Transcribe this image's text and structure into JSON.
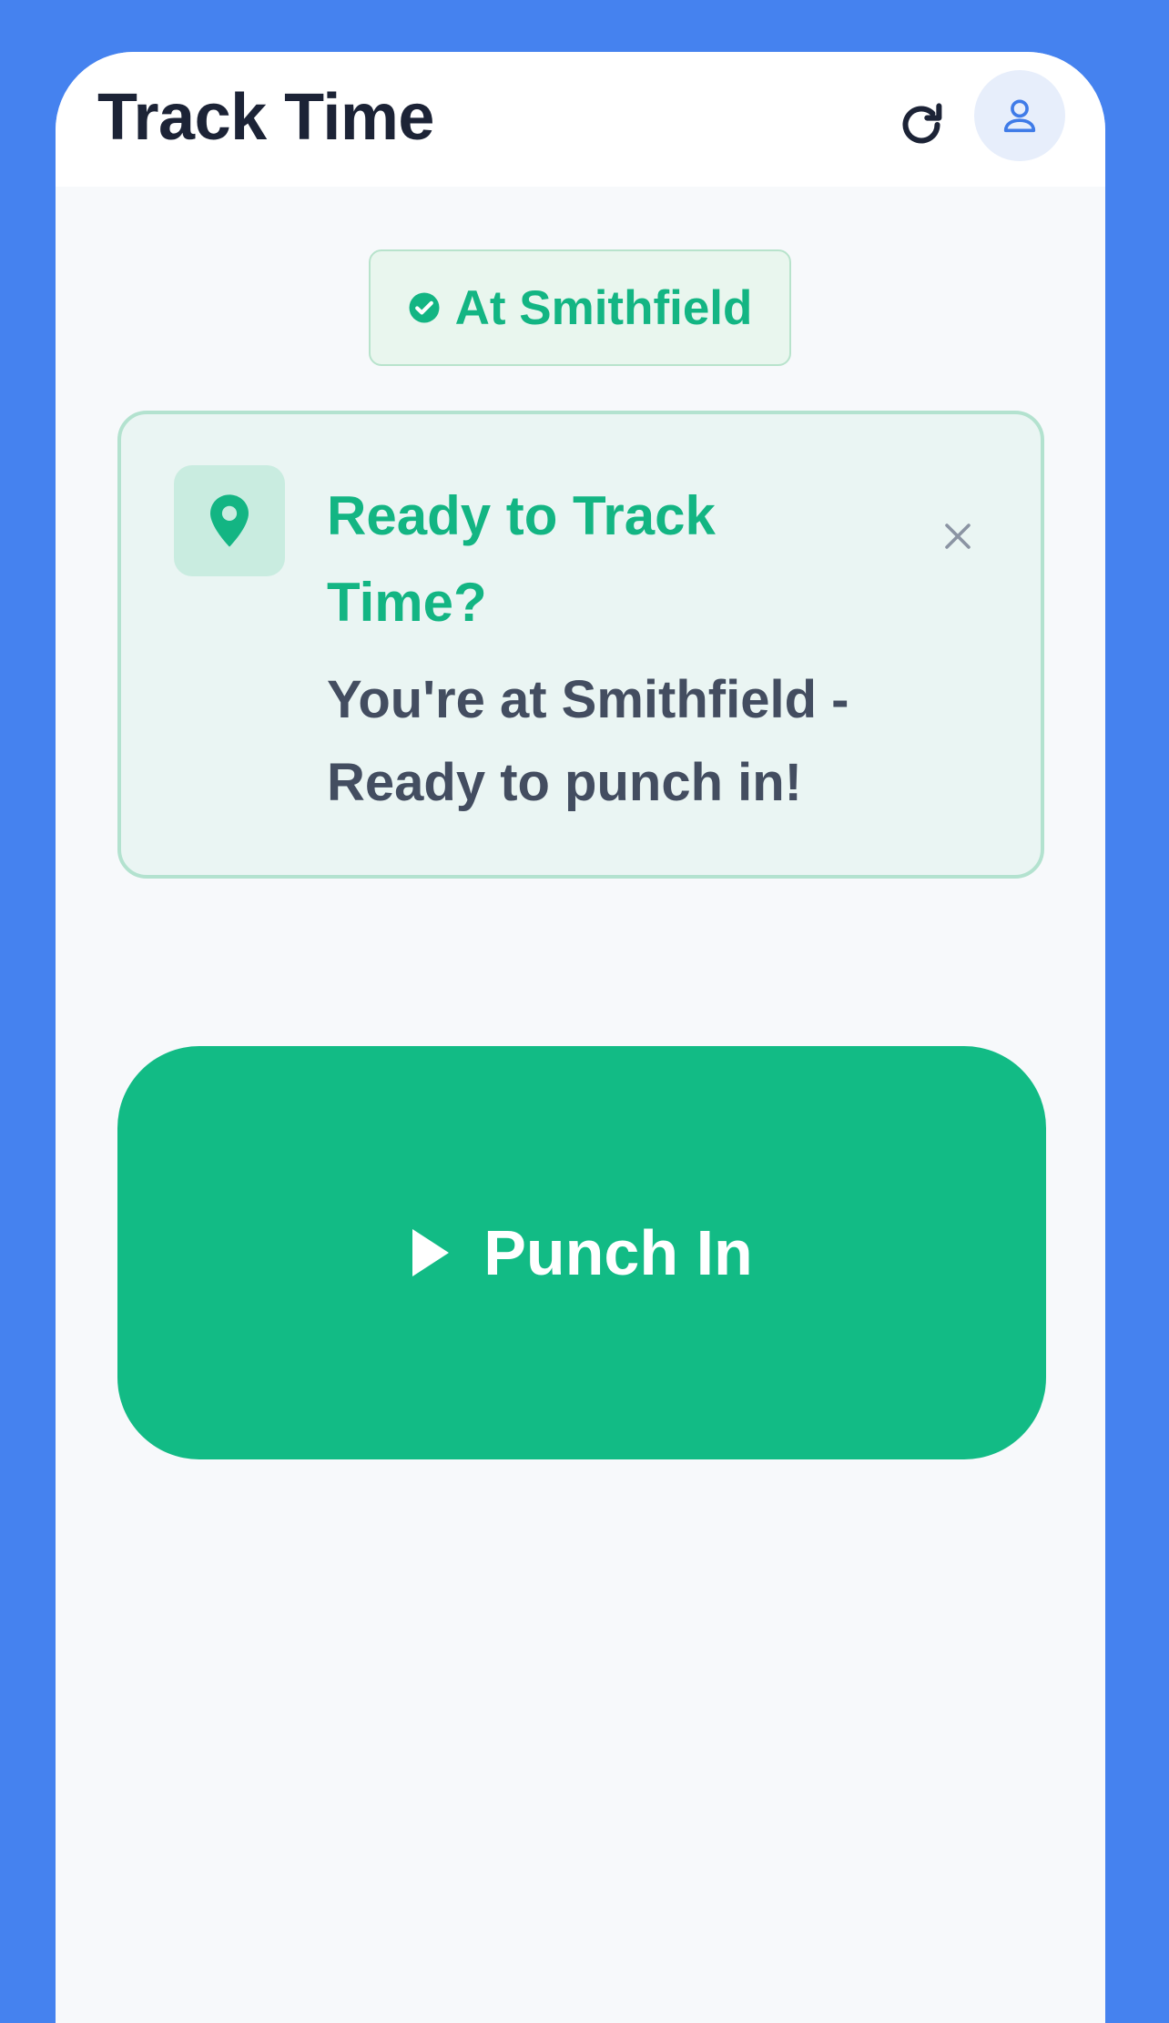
{
  "appbar": {
    "title": "Track Time",
    "refresh_icon": "refresh-icon",
    "profile_icon": "user-icon"
  },
  "location_chip": {
    "label": "At Smithfield",
    "icon": "check-circle-icon"
  },
  "banner": {
    "icon": "map-pin-icon",
    "title": "Ready to Track Time?",
    "message": "You're at Smithfield - Ready to punch in!",
    "close_icon": "close-icon"
  },
  "punch_button": {
    "label": "Punch In",
    "icon": "play-icon"
  },
  "colors": {
    "background": "#4582ef",
    "accent_green": "#12bb85",
    "title_dark": "#1c2336",
    "message_gray": "#434d60"
  }
}
